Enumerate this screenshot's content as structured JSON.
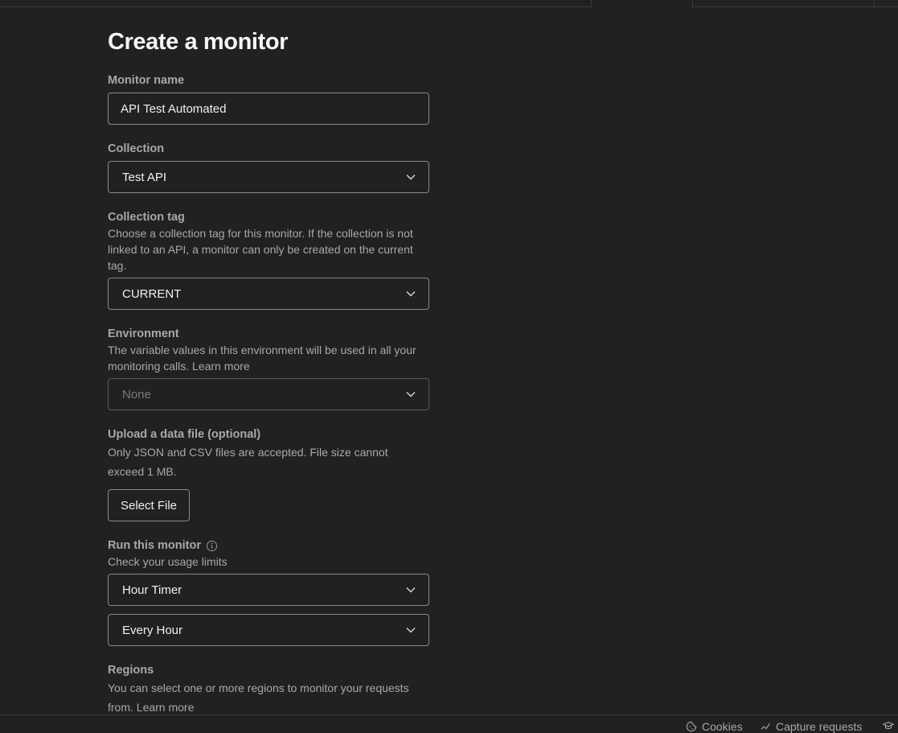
{
  "form": {
    "title": "Create a monitor",
    "monitor_name": {
      "label": "Monitor name",
      "value": "API Test Automated"
    },
    "collection": {
      "label": "Collection",
      "value": "Test API"
    },
    "collection_tag": {
      "label": "Collection tag",
      "description": "Choose a collection tag for this monitor. If the collection is not linked to an API, a monitor can only be created on the current tag.",
      "value": "CURRENT"
    },
    "environment": {
      "label": "Environment",
      "description": "The variable values in this environment will be used in all your monitoring calls. Learn more",
      "value": "None"
    },
    "data_file": {
      "label": "Upload a data file (optional)",
      "description": "Only JSON and CSV files are accepted. File size cannot exceed 1 MB.",
      "button": "Select File"
    },
    "run": {
      "label": "Run this monitor",
      "description": "Check your usage limits",
      "timer": "Hour Timer",
      "frequency": "Every Hour"
    },
    "regions": {
      "label": "Regions",
      "description": "You can select one or more regions to monitor your requests from. Learn more"
    }
  },
  "footer": {
    "cookies": "Cookies",
    "capture": "Capture requests"
  },
  "icons": {
    "dropdown": "chevron-down-icon",
    "info": "info-icon",
    "cookies": "cookie-icon",
    "capture": "capture-icon",
    "bootcamp": "graduation-cap-icon"
  }
}
